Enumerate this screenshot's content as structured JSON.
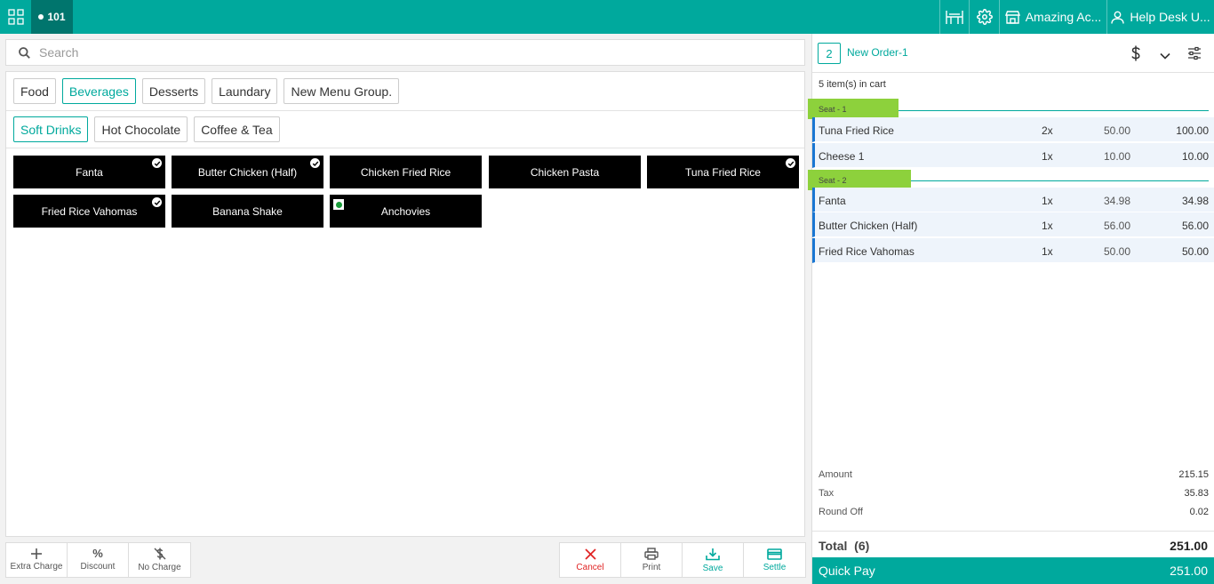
{
  "topbar": {
    "table_number": "101",
    "outlet_name": "Amazing Ac...",
    "user_name": "Help Desk U...",
    "accent_color": "#00a99d"
  },
  "search": {
    "placeholder": "Search"
  },
  "menu_groups": [
    "Food",
    "Beverages",
    "Desserts",
    "Laundary",
    "New Menu Group."
  ],
  "active_group": "Beverages",
  "sub_groups": [
    "Soft Drinks",
    "Hot Chocolate",
    "Coffee & Tea"
  ],
  "active_sub_group": "Soft Drinks",
  "menu_items": [
    {
      "label": "Fanta",
      "selected": true,
      "veg": false
    },
    {
      "label": "Butter Chicken (Half)",
      "selected": true,
      "veg": false
    },
    {
      "label": "Chicken Fried Rice",
      "selected": false,
      "veg": false
    },
    {
      "label": "Chicken Pasta",
      "selected": false,
      "veg": false
    },
    {
      "label": "Tuna Fried Rice",
      "selected": true,
      "veg": false
    },
    {
      "label": "Fried Rice Vahomas",
      "selected": true,
      "veg": false
    },
    {
      "label": "Banana Shake",
      "selected": false,
      "veg": false
    },
    {
      "label": "Anchovies",
      "selected": false,
      "veg": true
    }
  ],
  "left_actions": [
    "Extra Charge",
    "Discount",
    "No Charge"
  ],
  "right_actions": [
    "Cancel",
    "Print",
    "Save",
    "Settle"
  ],
  "order": {
    "number": "2",
    "name": "New Order-1",
    "cart_count": "5 item(s) in cart",
    "seats": [
      {
        "label": "Seat - 1",
        "lines": [
          {
            "name": "Tuna Fried Rice",
            "qty": "2x",
            "price": "50.00",
            "total": "100.00"
          },
          {
            "name": "Cheese 1",
            "qty": "1x",
            "price": "10.00",
            "total": "10.00"
          }
        ]
      },
      {
        "label": "Seat - 2",
        "lines": [
          {
            "name": "Fanta",
            "qty": "1x",
            "price": "34.98",
            "total": "34.98"
          },
          {
            "name": "Butter Chicken (Half)",
            "qty": "1x",
            "price": "56.00",
            "total": "56.00"
          },
          {
            "name": "Fried Rice Vahomas",
            "qty": "1x",
            "price": "50.00",
            "total": "50.00"
          }
        ]
      }
    ],
    "summary": {
      "amount_label": "Amount",
      "amount": "215.15",
      "tax_label": "Tax",
      "tax": "35.83",
      "roundoff_label": "Round Off",
      "roundoff": "0.02"
    },
    "total_label": "Total  (6)",
    "total": "251.00",
    "quickpay_label": "Quick Pay",
    "quickpay": "251.00"
  }
}
